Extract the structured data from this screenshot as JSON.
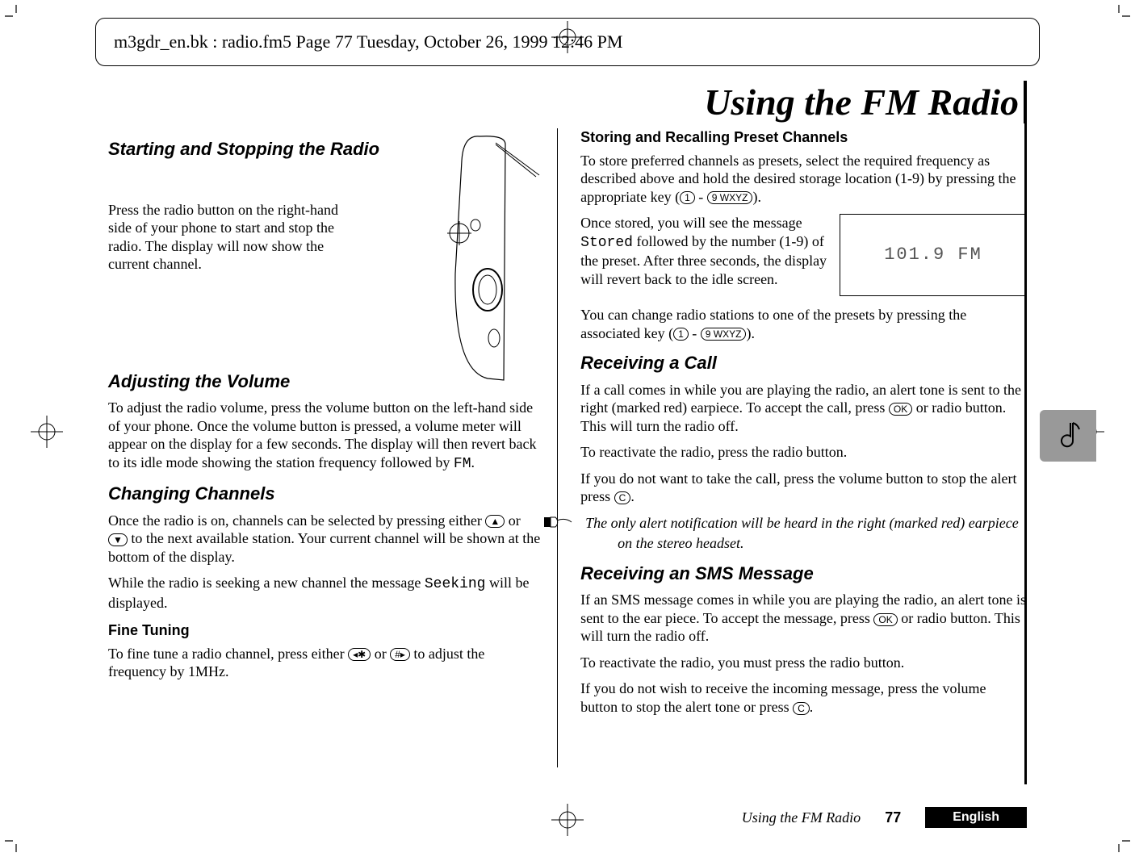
{
  "printmeta": {
    "header_line": "m3gdr_en.bk : radio.fm5  Page 77  Tuesday, October 26, 1999  12:46 PM"
  },
  "title": "Using the FM Radio",
  "left": {
    "sec1_title": "Starting and Stopping the Radio",
    "sec1_body": "Press the radio button on the right-hand side of your phone to start and stop the radio. The display will now show the current channel.",
    "sec2_title": "Adjusting the Volume",
    "sec2_body": "To adjust the radio volume, press the volume button on the left-hand side of your phone. Once the volume button is pressed, a volume meter will appear on the display for a few seconds. The display will then revert back to its idle mode showing the station frequency followed by ",
    "sec2_fm": "FM",
    "sec2_body_end": ".",
    "sec3_title": "Changing Channels",
    "sec3_body_a": "Once the radio is on, channels can be selected by pressing either ",
    "sec3_key_up": "▲",
    "sec3_body_b": " or ",
    "sec3_key_down": "▼",
    "sec3_body_c": " to the next available station. Your current channel will be shown at the bottom of the display.",
    "sec3_body2_a": "While the radio is seeking a new channel the message ",
    "sec3_seeking": "Seeking",
    "sec3_body2_b": " will be displayed.",
    "sec3_sub_title": "Fine Tuning",
    "sec3_sub_body_a": "To fine tune a radio channel, press either ",
    "sec3_key_star": "◂✱",
    "sec3_sub_body_b": " or ",
    "sec3_key_hash": "#▸",
    "sec3_sub_body_c": " to adjust the frequency by 1MHz."
  },
  "right": {
    "sub1_title": "Storing and Recalling Preset Channels",
    "sub1_body_a": "To store preferred channels as presets, select the required frequency as described above and hold the desired storage location (1-9) by pressing the appropriate key (",
    "key_1": "1",
    "sub1_body_b": " - ",
    "key_9": "9 WXYZ",
    "sub1_body_c": ").",
    "lcd_value": "101.9 FM",
    "sub1_body2_a": "Once stored, you will see the message ",
    "stored_word": "Stored",
    "sub1_body2_b": " followed by the number (1-9) of the preset. After three seconds, the display will revert back to the idle screen.",
    "sub1_body3_a": "You can change radio stations to one of the presets by pressing the associated key (",
    "sub1_body3_b": " - ",
    "sub1_body3_c": ").",
    "sec2_title": "Receiving a Call",
    "sec2_body_a": "If a call comes in while you are playing the radio, an alert tone is sent to the right (marked red) earpiece. To accept the call, press ",
    "key_ok": "OK",
    "sec2_body_b": " or radio button. This will turn the radio off.",
    "sec2_body2": "To reactivate the radio, press the radio button.",
    "sec2_body3_a": "If you do not want to take the call, press the volume button to stop the alert press ",
    "key_c": "C",
    "sec2_body3_b": ".",
    "note_text": "The only alert notification will be heard in the right (marked red) earpiece on the stereo headset.",
    "sec3_title": "Receiving an SMS Message",
    "sec3_body_a": "If an SMS message comes in while you are playing the radio, an alert tone is sent to the ear piece. To accept the message, press ",
    "sec3_body_b": " or radio button. This will turn the radio off.",
    "sec3_body2": "To reactivate the radio, you must press the radio button.",
    "sec3_body3_a": "If you do not wish to receive the incoming message, press the volume button to stop the alert tone or press ",
    "sec3_body3_b": "."
  },
  "footer": {
    "ftitle": "Using the FM Radio",
    "page": "77",
    "language": "English"
  }
}
